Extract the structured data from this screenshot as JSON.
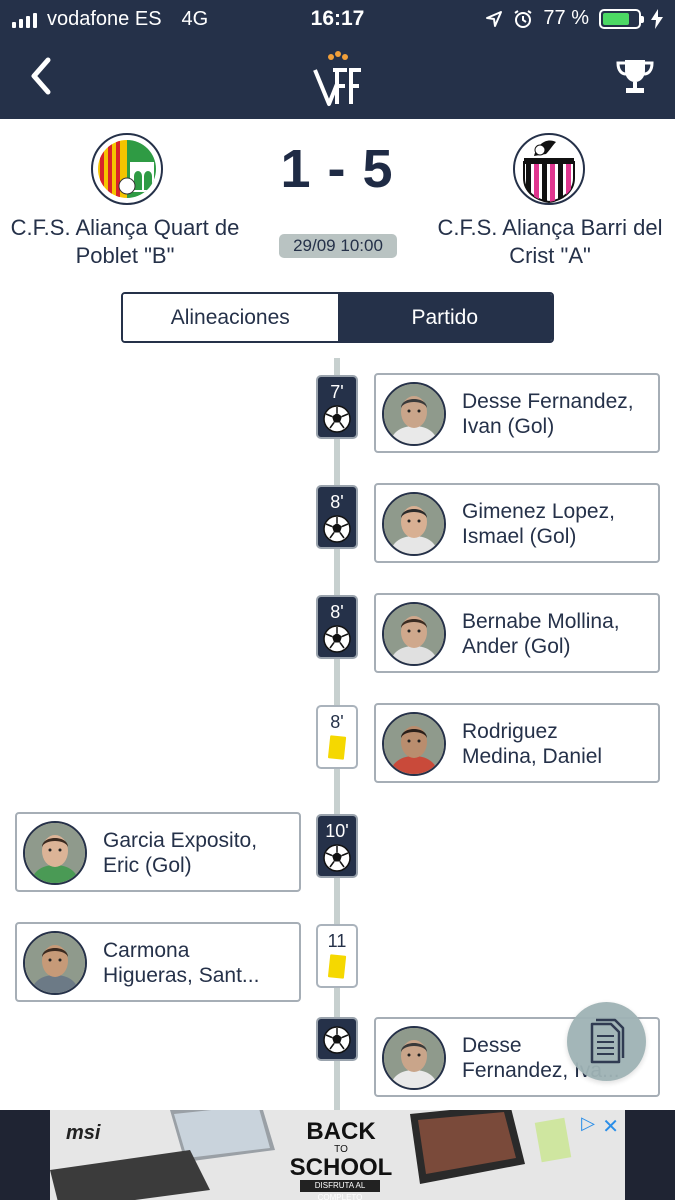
{
  "status": {
    "carrier": "vodafone ES",
    "network": "4G",
    "time": "16:17",
    "battery": "77 %",
    "battery_level": 0.77
  },
  "nav": {
    "back_icon": "chevron-left-icon",
    "logo": "VFF",
    "trophy_icon": "trophy-icon"
  },
  "match": {
    "home": {
      "name": "C.F.S. Aliança Quart de Poblet \"B\""
    },
    "away": {
      "name": "C.F.S. Aliança Barri del Crist \"A\""
    },
    "score": "1 - 5",
    "datetime": "29/09 10:00"
  },
  "tabs": [
    {
      "label": "Alineaciones"
    },
    {
      "label": "Partido"
    }
  ],
  "events": [
    {
      "minute": "7'",
      "type": "goal",
      "side": "away",
      "line1": "Desse Fernandez,",
      "line2": "Ivan (Gol)"
    },
    {
      "minute": "8'",
      "type": "goal",
      "side": "away",
      "line1": "Gimenez Lopez,",
      "line2": "Ismael (Gol)"
    },
    {
      "minute": "8'",
      "type": "goal",
      "side": "away",
      "line1": "Bernabe Mollina,",
      "line2": "Ander (Gol)"
    },
    {
      "minute": "8'",
      "type": "yellow-card",
      "side": "away",
      "line1": "Rodriguez",
      "line2": "Medina, Daniel"
    },
    {
      "minute": "10'",
      "type": "goal",
      "side": "home",
      "line1": "Garcia Exposito,",
      "line2": "Eric (Gol)"
    },
    {
      "minute": "11",
      "type": "yellow-card",
      "side": "home",
      "line1": "Carmona",
      "line2": "Higueras, Sant..."
    },
    {
      "minute": "",
      "type": "goal",
      "side": "away",
      "line1": "Desse",
      "line2": "Fernandez, Iva..."
    }
  ],
  "fab": {
    "icon": "document-icon"
  },
  "ad": {
    "brand": "msi",
    "headline1": "BACK",
    "headline2": "TO",
    "headline3": "SCHOOL",
    "tagline": "DISFRUTA AL COMPLETO",
    "close": "✕",
    "adchoices": "▷"
  },
  "colors": {
    "navy": "#253149",
    "timeline": "#c7d0cf",
    "yellow_card": "#f5d800",
    "battery": "#4cd964"
  }
}
